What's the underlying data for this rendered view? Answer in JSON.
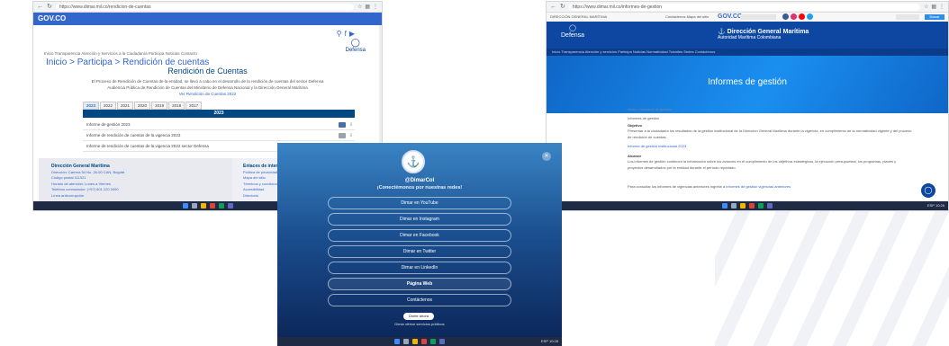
{
  "shot1": {
    "url": "https://www.dimar.mil.co/rendicion-de-cuentas",
    "brand": "GOV.CO",
    "logo_text": "Defensa",
    "menu": "Inicio  Transparencia  Atención y Servicios a la Ciudadanía  Participa  Noticias  Contacto",
    "breadcrumb_home": "Inicio",
    "breadcrumb_section": "Participa",
    "breadcrumb_current": "Rendición de cuentas",
    "sep": ">",
    "title": "Rendición de Cuentas",
    "description_1": "El Proceso de Rendición de Cuentas de la entidad, se llevó a cabo en el desarrollo de la rendición de cuentas del sector Defensa",
    "description_2": "Audiencia Pública de Rendición de Cuentas del Ministerio de Defensa Nacional y la Dirección General Marítima",
    "link": "Ver Rendición de Cuentas 2022",
    "tabs": [
      "2023",
      "2022",
      "2021",
      "2020",
      "2019",
      "2018",
      "2017"
    ],
    "table_header": "2023",
    "rows": [
      "Informe de gestión 2023",
      "Informe de rendición de cuentas de la vigencia 2023",
      "Informe de rendición de cuentas de la vigencia 2022 sector Defensa"
    ],
    "footer_left_title": "Dirección General Marítima",
    "footer_left_lines": [
      "Dirección: Carrera 54 No. 26-50 CAN, Bogotá",
      "Código postal 111321",
      "Horario de atención: Lunes a Viernes",
      "Teléfono conmutador: (+57) 601 220 0490",
      "Línea anticorrupción"
    ],
    "footer_right_title": "Enlaces de interés",
    "footer_right_lines": [
      "Política de privacidad",
      "Mapa del sitio",
      "Términos y condiciones",
      "Accesibilidad",
      "Directorio"
    ],
    "tray": "ESP  10:24"
  },
  "shot2": {
    "url": "https://www.dimar.mil.co/informes-de-gestion",
    "top_left": "DIRECCIÓN GENERAL MARÍTIMA",
    "top_mid": "Contáctenos  Mapa del sitio",
    "gov_brand": "GOV.CO",
    "search_button": "Buscar",
    "defensa": "Defensa",
    "brand_title": "Dirección General Marítima",
    "brand_sub": "Autoridad Marítima Colombiana",
    "nav": "Inicio  Transparencia  Atención y servicios  Participa  Noticias  Normatividad  Trámites  Sedes  Contáctenos",
    "banner_title": "Informes de gestión",
    "crumb": "Inicio > Informes de gestión",
    "p1_title": "Informes de gestión",
    "p2_title": "Objetivo",
    "p2_text": "Presentar a la ciudadanía los resultados de la gestión institucional de la Dirección General Marítima durante la vigencia, en cumplimiento de la normatividad vigente y del proceso de rendición de cuentas.",
    "p3_link": "Informe de gestión institucional 2023",
    "p4_title": "Alcance",
    "p4_text": "Los informes de gestión contienen la información sobre los avances en el cumplimiento de los objetivos estratégicos, la ejecución presupuestal, los programas, planes y proyectos desarrollados por la entidad durante el período reportado.",
    "p5_text": "Para consultar los informes de vigencias anteriores ingrese a",
    "p5_link": "informes de gestión vigencias anteriores",
    "chat_icon": "chat-icon",
    "tray": "ESP  10:26"
  },
  "shot3": {
    "handle": "@DimarCol",
    "tagline": "¡Conectémonos por nuestras redes!",
    "links": [
      "Dimar en YouTube",
      "Dimar en Instagram",
      "Dimar en Facebook",
      "Dimar en Twitter",
      "Dimar en LinkedIn",
      "Página Web",
      "Contáctenos"
    ],
    "join_button": "Únete ahora",
    "footer": "Dimar ofrece servicios públicos",
    "tray": "ESP  10:28"
  },
  "colors": {
    "govco_blue": "#3366cc",
    "armada_navy": "#0d47a1",
    "taskbar": "#1f2a44"
  }
}
